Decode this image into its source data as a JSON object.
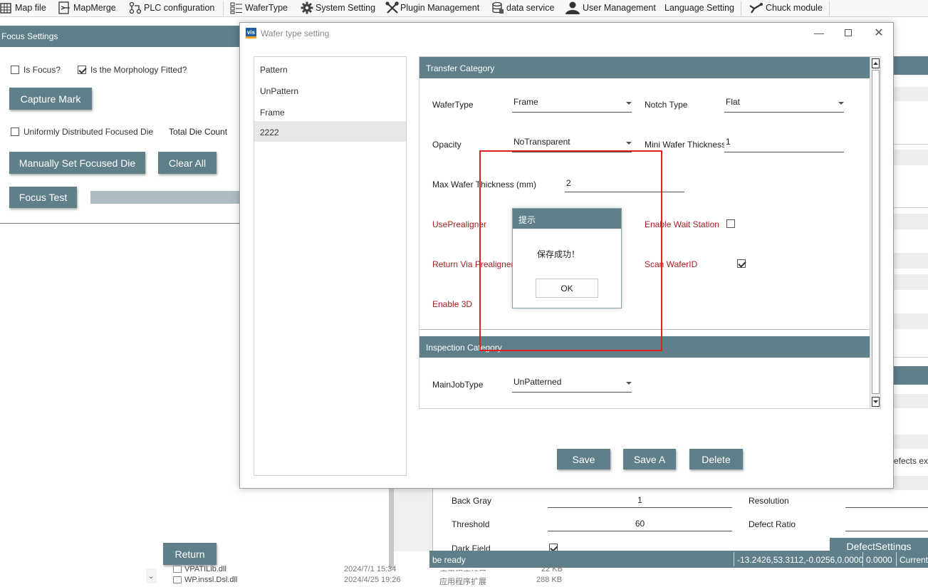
{
  "toolbar": {
    "items": [
      {
        "label": "Map file",
        "icon": "grid-icon"
      },
      {
        "label": "MapMerge",
        "icon": "merge-icon"
      },
      {
        "label": "PLC configuration",
        "icon": "plc-icon"
      },
      {
        "label": "WaferType",
        "icon": "list-icon"
      },
      {
        "label": "System Setting",
        "icon": "gear-icon"
      },
      {
        "label": "Plugin Management",
        "icon": "tools-icon"
      },
      {
        "label": "data service",
        "icon": "database-icon"
      },
      {
        "label": "User Management",
        "icon": "user-icon"
      },
      {
        "label": "Language Setting",
        "icon": ""
      },
      {
        "label": "Chuck module",
        "icon": "chuck-icon"
      }
    ]
  },
  "focus_panel": {
    "title": "Focus Settings",
    "is_focus": {
      "label": "Is Focus?",
      "checked": false
    },
    "morphology": {
      "label": "Is the Morphology Fitted?",
      "checked": true
    },
    "capture_mark": "Capture Mark",
    "uniform": {
      "label": "Uniformly Distributed Focused Die",
      "checked": false
    },
    "total_die_count": "Total Die Count",
    "manual_set": "Manually Set Focused Die",
    "clear_all": "Clear All",
    "focus_test": "Focus Test",
    "return": "Return"
  },
  "background": {
    "defects_text": "efects exc",
    "back_gray": {
      "label": "Back Gray",
      "value": "1"
    },
    "threshold": {
      "label": "Threshold",
      "value": "60"
    },
    "resolution": "Resolution",
    "defect_ratio": "Defect Ratio",
    "dark_field": "Dark Field",
    "defect_settings": "DefectSettings",
    "files": [
      {
        "name": "VPATILib.dll",
        "date": "2024/7/1 15:34",
        "type": "应用程序扩展",
        "size": "22 KB"
      },
      {
        "name": "WP.inssl.Dsl.dll",
        "date": "2024/4/25 19:26",
        "type": "应用程序扩展",
        "size": "288 KB"
      }
    ]
  },
  "status_bar": {
    "status": "be ready",
    "coords": "-13.2426,53.3112,-0.0256,0.0000",
    "value": "0.0000",
    "current": "Current"
  },
  "dialog": {
    "title": "Wafer type setting",
    "logo": "vis",
    "wafer_types": [
      "Pattern",
      "UnPattern",
      "Frame",
      "2222"
    ],
    "selected_index": 3,
    "transfer": {
      "header": "Transfer Category",
      "wafer_type": {
        "label": "WaferType",
        "value": "Frame"
      },
      "notch_type": {
        "label": "Notch Type",
        "value": "Flat"
      },
      "opacity": {
        "label": "Opacity",
        "value": "NoTransparent"
      },
      "mini_thickness": {
        "label": "Mini Wafer Thickness",
        "value": "1"
      },
      "max_thickness": {
        "label": "Max Wafer Thickness (mm)",
        "value": "2"
      },
      "use_prealigner": "UsePrealigner",
      "enable_wait_station": {
        "label": "Enable Wait Station",
        "checked": false
      },
      "return_via_prealigner": "Return Via Prealigner",
      "scan_wafer_id": {
        "label": "Scan WaferID",
        "checked": true
      },
      "enable_3d": "Enable 3D"
    },
    "inspection": {
      "header": "Inspection Category",
      "main_job_type": {
        "label": "MainJobType",
        "value": "UnPatterned"
      }
    },
    "buttons": {
      "save": "Save",
      "save_a": "Save A",
      "delete": "Delete"
    }
  },
  "message_box": {
    "title": "提示",
    "text": "保存成功！",
    "ok": "OK"
  },
  "colors": {
    "header_slate": "#5f7f89",
    "label_red": "#a32020",
    "highlight_red": "#e02020"
  }
}
